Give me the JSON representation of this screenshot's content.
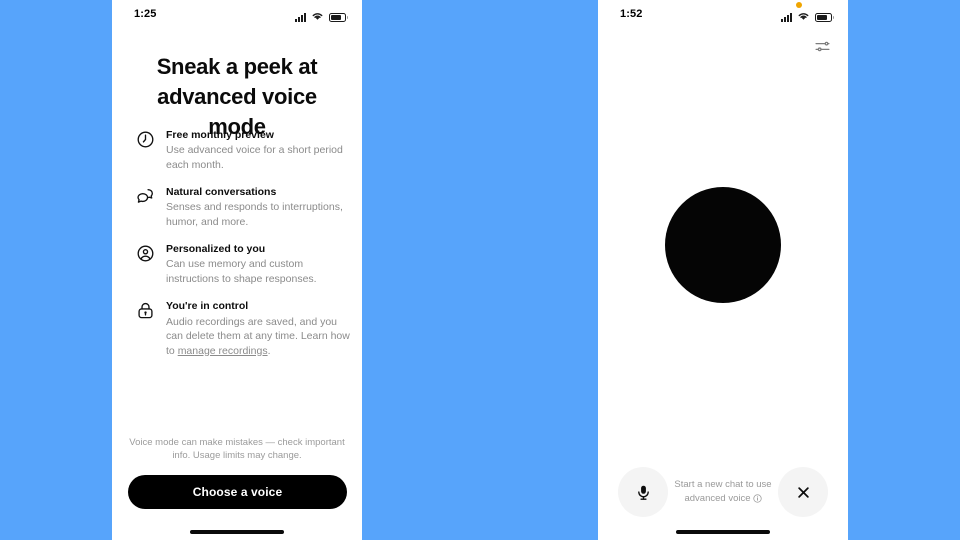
{
  "background_color": "#57A4FB",
  "left_phone": {
    "status_bar": {
      "time": "1:25",
      "icons": [
        "cellular-signal-icon",
        "wifi-icon",
        "battery-icon"
      ]
    },
    "headline": "Sneak a peek at advanced voice mode",
    "features": [
      {
        "icon": "clock-icon",
        "title": "Free monthly preview",
        "description": "Use advanced voice for a short period each month."
      },
      {
        "icon": "chat-bubbles-icon",
        "title": "Natural conversations",
        "description": "Senses and responds to interruptions, humor, and more."
      },
      {
        "icon": "person-circle-icon",
        "title": "Personalized to you",
        "description": "Can use memory and custom instructions to shape responses."
      },
      {
        "icon": "lock-icon",
        "title": "You're in control",
        "description_before_link": "Audio recordings are saved, and you can delete them at any time. Learn how to ",
        "link_text": "manage recordings",
        "description_after_link": "."
      }
    ],
    "disclaimer": "Voice mode can make mistakes — check important info. Usage limits may change.",
    "cta_label": "Choose a voice",
    "home_indicator": true
  },
  "right_phone": {
    "status_bar": {
      "time": "1:52",
      "privacy_dot_color": "#F0A500",
      "icons": [
        "privacy-indicator-dot",
        "cellular-signal-icon",
        "wifi-icon",
        "battery-icon"
      ]
    },
    "tune_button_icon": "sliders-icon",
    "voice_orb_color": "#050505",
    "bottom_bar": {
      "mic_icon": "microphone-icon",
      "hint_line_1": "Start a new chat to use",
      "hint_line_2": "advanced voice",
      "hint_info_icon": "info-icon",
      "close_icon": "close-icon"
    },
    "home_indicator": true
  }
}
